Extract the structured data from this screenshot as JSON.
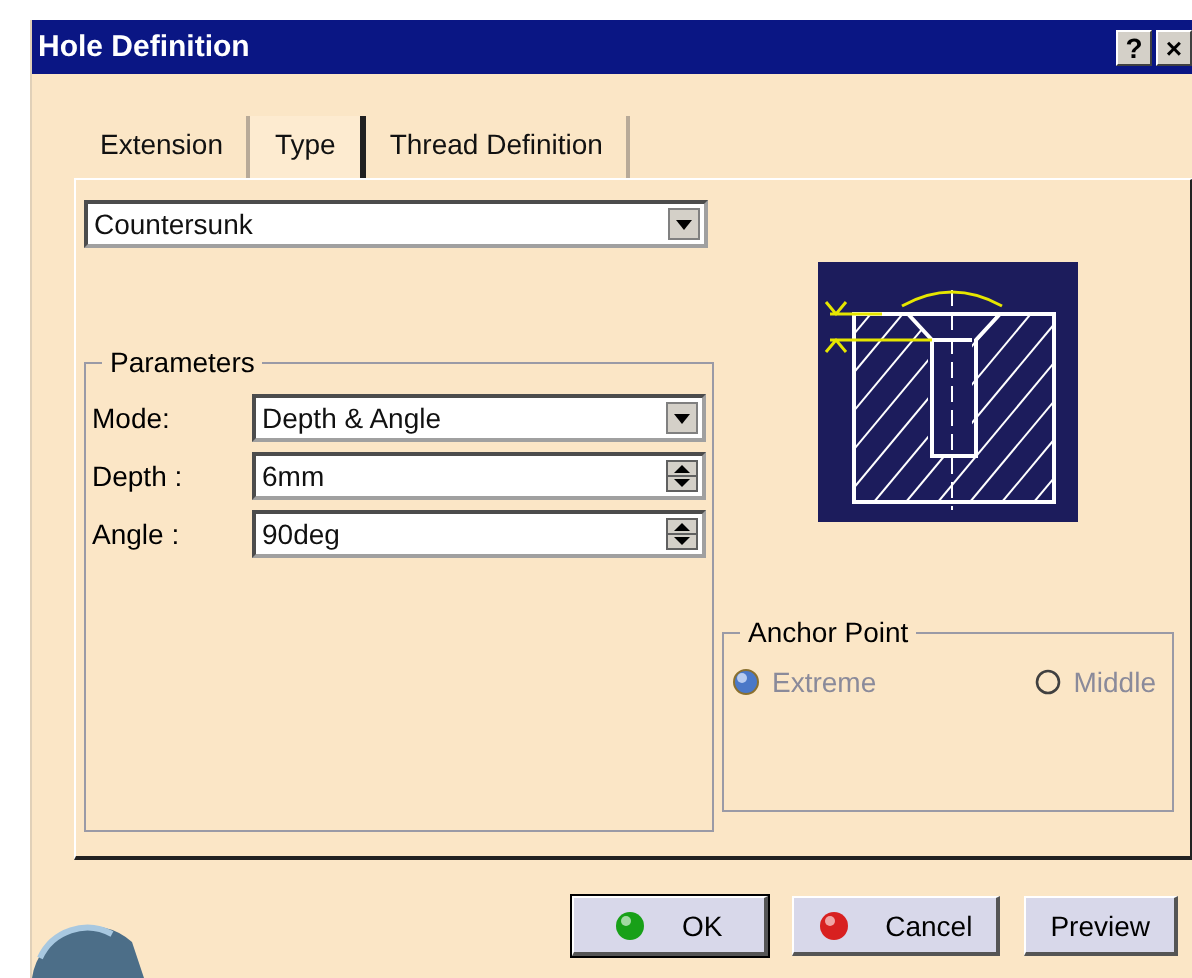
{
  "window": {
    "title": "Hole Definition",
    "help": "?",
    "close": "×"
  },
  "tabs": [
    {
      "label": "Extension",
      "selected": false
    },
    {
      "label": "Type",
      "selected": true
    },
    {
      "label": "Thread Definition",
      "selected": false
    }
  ],
  "hole_type": {
    "value": "Countersunk"
  },
  "parameters": {
    "title": "Parameters",
    "fields": [
      {
        "kind": "dropdown",
        "label": "Mode:",
        "value": "Depth & Angle"
      },
      {
        "kind": "spinner",
        "label": "Depth :",
        "value": "6mm"
      },
      {
        "kind": "spinner",
        "label": "Angle :",
        "value": "90deg"
      }
    ]
  },
  "anchor_point": {
    "title": "Anchor Point",
    "disabled": true,
    "options": [
      {
        "label": "Extreme",
        "selected": true
      },
      {
        "label": "Middle",
        "selected": false
      }
    ]
  },
  "buttons": [
    {
      "label": "OK",
      "kind": "ok",
      "default": true
    },
    {
      "label": "Cancel",
      "kind": "cancel",
      "default": false
    },
    {
      "label": "Preview",
      "kind": "plain",
      "default": false
    }
  ]
}
